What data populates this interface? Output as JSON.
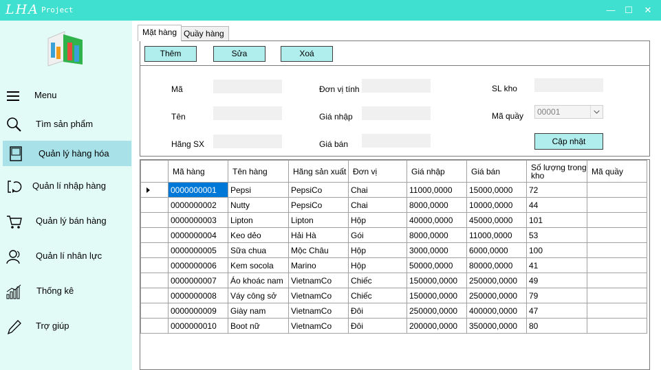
{
  "app": {
    "logo": "LHA",
    "subtitle": "Project",
    "controls": {
      "minimize": "—",
      "maximize": "☐",
      "close": "✕"
    }
  },
  "sidebar": {
    "items": [
      {
        "label": "Menu",
        "icon": "hamburger-icon"
      },
      {
        "label": "Tìm sản phẩm",
        "icon": "search-icon"
      },
      {
        "label": "Quản lý hàng hóa",
        "icon": "book-icon",
        "active": true
      },
      {
        "label": "Quản lí nhập hàng",
        "icon": "import-icon"
      },
      {
        "label": "Quản lý bán hàng",
        "icon": "cart-icon"
      },
      {
        "label": "Quản lí nhân lực",
        "icon": "users-icon"
      },
      {
        "label": "Thống kê",
        "icon": "chart-icon"
      },
      {
        "label": "Trợ giúp",
        "icon": "pencil-icon"
      }
    ]
  },
  "tabs": [
    {
      "label": "Mặt hàng",
      "active": true
    },
    {
      "label": "Quầy hàng",
      "active": false
    }
  ],
  "toolbar": {
    "add_label": "Thêm",
    "edit_label": "Sửa",
    "delete_label": "Xoá"
  },
  "form": {
    "ma_label": "Mã",
    "ten_label": "Tên",
    "hang_sx_label": "Hãng SX",
    "don_vi_label": "Đơn vị tính",
    "gia_nhap_label": "Giá nhập",
    "gia_ban_label": "Giá bán",
    "sl_kho_label": "SL kho",
    "ma_quay_label": "Mã quầy",
    "ma_quay_value": "00001",
    "update_label": "Cập nhật"
  },
  "grid": {
    "columns": [
      "Mã hàng",
      "Tên hàng",
      "Hãng sản xuất",
      "Đơn vị",
      "Giá nhập",
      "Giá bán",
      "Số lượng trong kho",
      "Mã quầy"
    ],
    "rows": [
      [
        "0000000001",
        "Pepsi",
        "PepsiCo",
        "Chai",
        "11000,0000",
        "15000,0000",
        "72",
        ""
      ],
      [
        "0000000002",
        "Nutty",
        "PepsiCo",
        "Chai",
        "8000,0000",
        "10000,0000",
        "44",
        ""
      ],
      [
        "0000000003",
        "Lipton",
        "Lipton",
        "Hộp",
        "40000,0000",
        "45000,0000",
        "101",
        ""
      ],
      [
        "0000000004",
        "Keo dẻo",
        "Hải Hà",
        "Gói",
        "8000,0000",
        "11000,0000",
        "53",
        ""
      ],
      [
        "0000000005",
        "Sữa chua",
        "Mộc Châu",
        "Hộp",
        "3000,0000",
        "6000,0000",
        "100",
        ""
      ],
      [
        "0000000006",
        "Kem socola",
        "Marino",
        "Hộp",
        "50000,0000",
        "80000,0000",
        "41",
        ""
      ],
      [
        "0000000007",
        "Áo khoác nam",
        "VietnamCo",
        "Chiếc",
        "150000,0000",
        "250000,0000",
        "49",
        ""
      ],
      [
        "0000000008",
        "Váy công sở",
        "VietnamCo",
        "Chiếc",
        "150000,0000",
        "250000,0000",
        "79",
        ""
      ],
      [
        "0000000009",
        "Giày nam",
        "VietnamCo",
        "Đôi",
        "250000,0000",
        "400000,0000",
        "47",
        ""
      ],
      [
        "0000000010",
        "Boot nữ",
        "VietnamCo",
        "Đôi",
        "200000,0000",
        "350000,0000",
        "80",
        ""
      ]
    ]
  }
}
